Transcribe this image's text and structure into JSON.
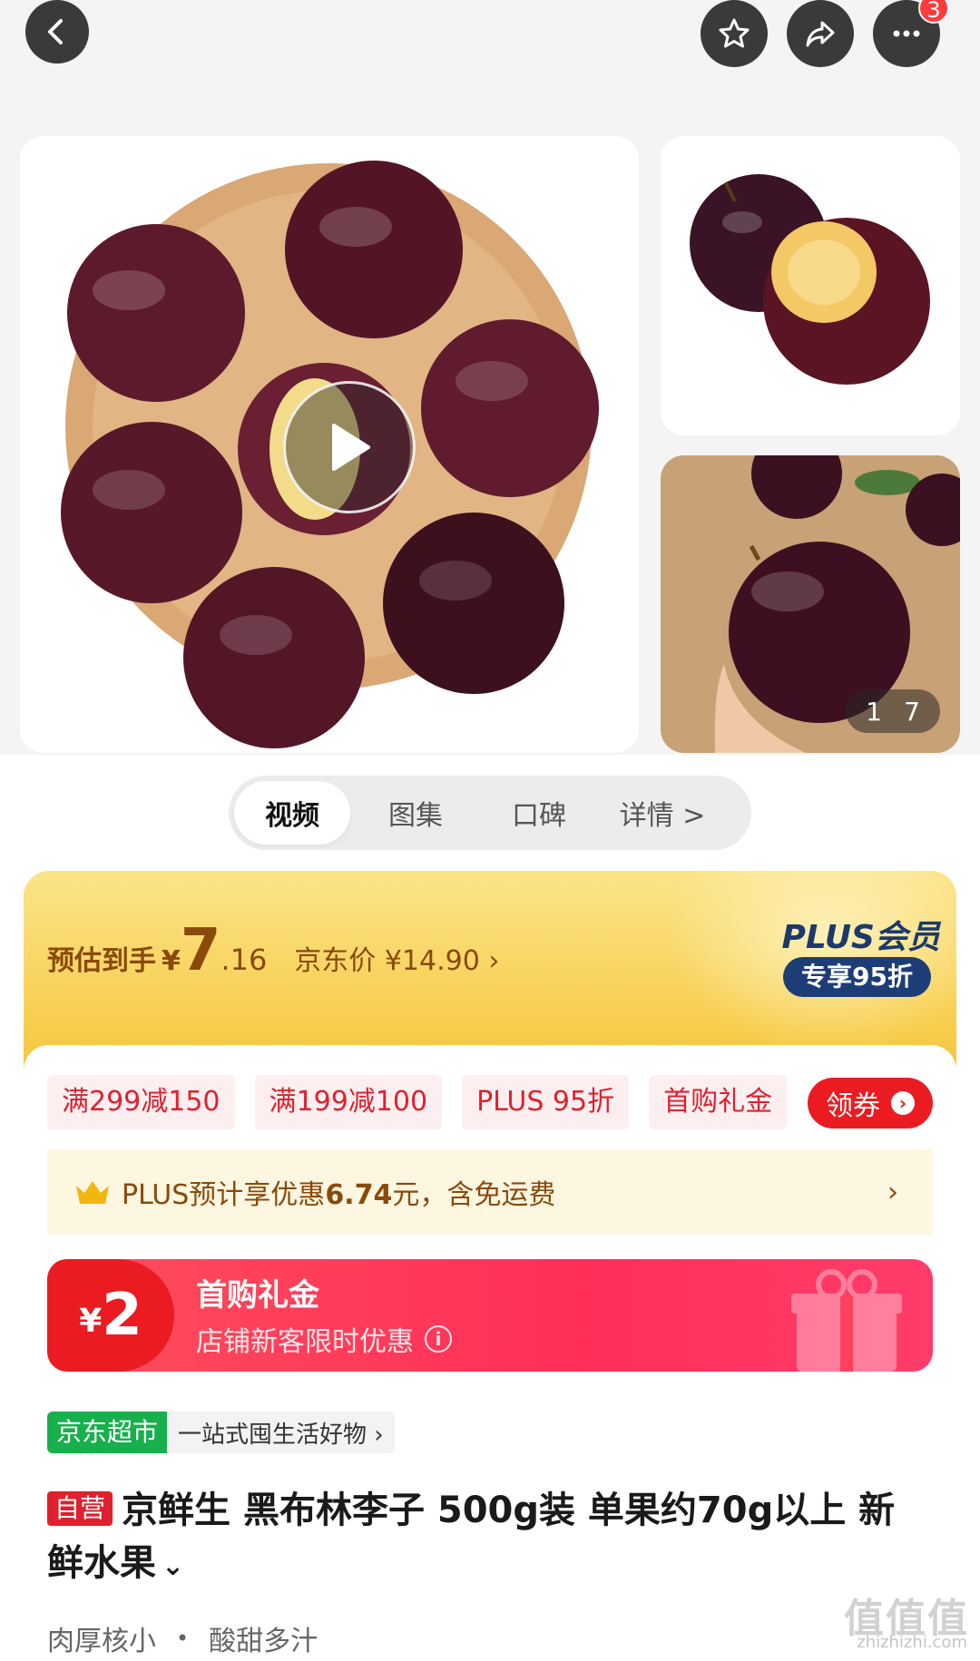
{
  "header": {
    "notification_count": "3"
  },
  "gallery": {
    "current_index": "1",
    "total": "7"
  },
  "tabs": [
    {
      "label": "视频"
    },
    {
      "label": "图集"
    },
    {
      "label": "口碑"
    },
    {
      "label": "详情 >"
    }
  ],
  "price": {
    "label": "预估到手",
    "yen": "¥",
    "integer": "7",
    "decimal": ".16",
    "jd_price": "京东价 ¥14.90 ›",
    "plus_title": "PLUS会员",
    "plus_badge": "专享95折"
  },
  "coupons": [
    "满299减150",
    "满199减100",
    "PLUS 95折",
    "首购礼金"
  ],
  "get_coupon_label": "领券",
  "plus_bar": {
    "prefix": "PLUS预计享优惠",
    "amount": "6.74",
    "suffix": "元，含免运费"
  },
  "gift": {
    "yen": "¥",
    "amount": "2",
    "title": "首购礼金",
    "subtitle": "店铺新客限时优惠"
  },
  "store": {
    "name": "京东超市",
    "slogan": "一站式囤生活好物 ›"
  },
  "product": {
    "self_tag": "自营",
    "title": "京鲜生 黑布林李子 500g装 单果约70g以上 新鲜水果",
    "features": [
      "肉厚核小",
      "酸甜多汁"
    ]
  },
  "watermark": {
    "text": "值值值",
    "url": "zhizhizhi.com"
  },
  "colors": {
    "accent_red": "#ea1c22",
    "plus_navy": "#1d3d77",
    "store_green": "#17b04d",
    "price_brown": "#8a4a0a"
  }
}
